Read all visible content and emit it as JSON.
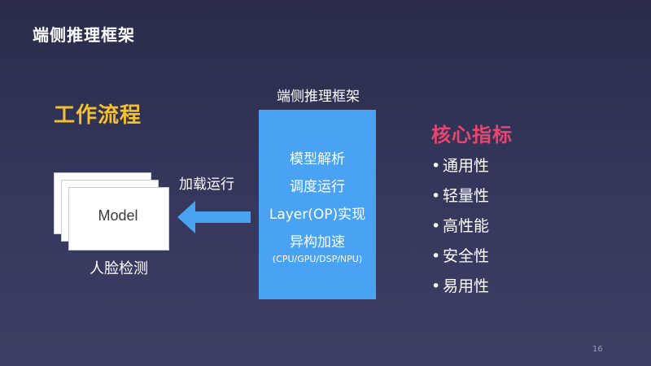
{
  "slide": {
    "title": "端侧推理框架",
    "page_number": "16"
  },
  "workflow": {
    "heading": "工作流程",
    "model_label": "Model",
    "arrow_label": "加载运行",
    "app_label": "人脸检测"
  },
  "framework": {
    "label": "端侧推理框架",
    "items": [
      "模型解析",
      "调度运行",
      "Layer(OP)实现",
      "异构加速"
    ],
    "note": "(CPU/GPU/DSP/NPU)"
  },
  "metrics": {
    "heading": "核心指标",
    "bullet": "•",
    "items": [
      "通用性",
      "轻量性",
      "高性能",
      "安全性",
      "易用性"
    ]
  },
  "colors": {
    "workflow_heading": "#f5c02d",
    "metrics_heading": "#e8466e",
    "framework_box": "#4aa3f2",
    "arrow": "#4aa3f2"
  }
}
